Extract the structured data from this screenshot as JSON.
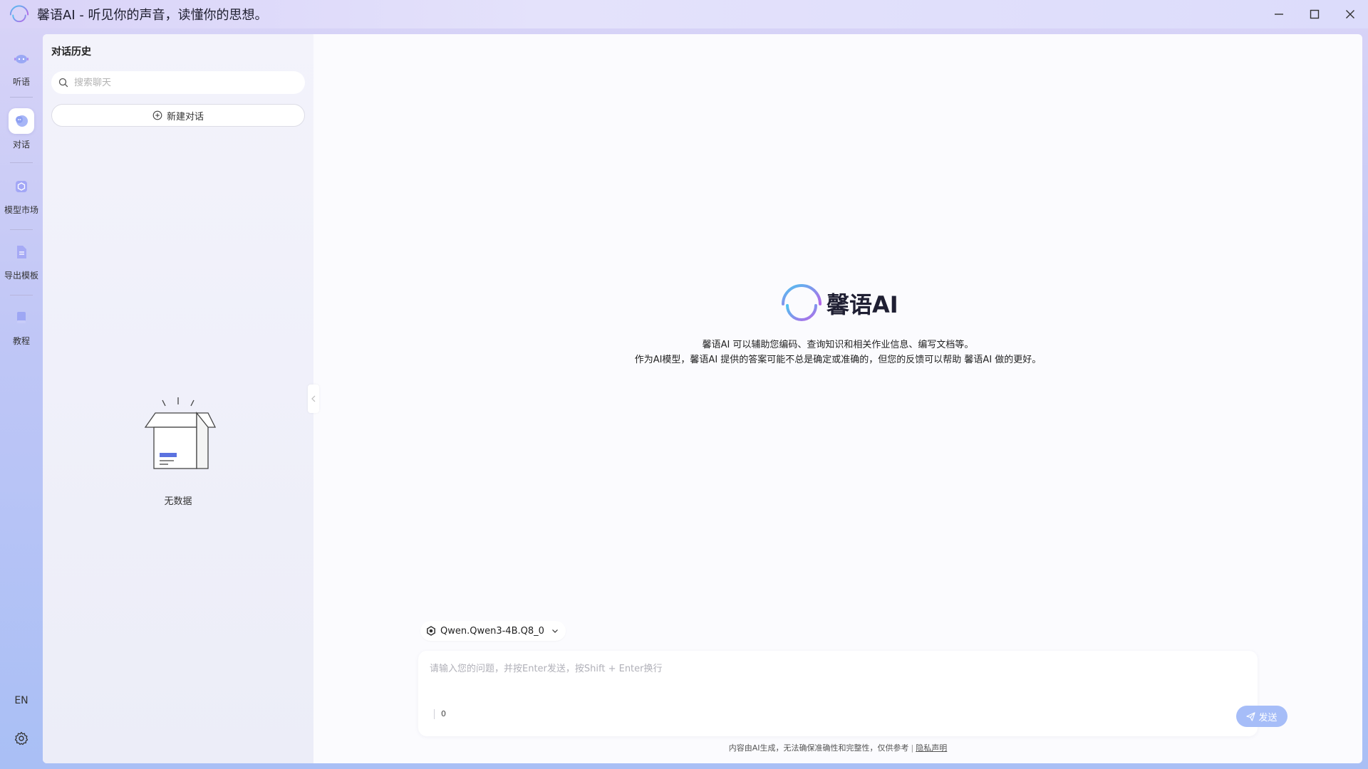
{
  "window": {
    "title": "馨语AI - 听见你的声音，读懂你的思想。",
    "controls": [
      "minimize",
      "maximize",
      "close"
    ]
  },
  "nav": {
    "items": [
      {
        "label": "听语",
        "icon": "listen-icon",
        "active": false
      },
      {
        "label": "对话",
        "icon": "chat-icon",
        "active": true
      },
      {
        "label": "模型市场",
        "icon": "model-market-icon",
        "active": false
      },
      {
        "label": "导出模板",
        "icon": "export-template-icon",
        "active": false
      },
      {
        "label": "教程",
        "icon": "tutorial-book-icon",
        "active": false
      }
    ],
    "language": "EN"
  },
  "history": {
    "title": "对话历史",
    "search_placeholder": "搜索聊天",
    "new_chat_label": "新建对话",
    "empty_label": "无数据"
  },
  "hero": {
    "brand": "馨语AI",
    "line1": "馨语AI 可以辅助您编码、查询知识和相关作业信息、编写文档等。",
    "line2": "作为AI模型，馨语AI 提供的答案可能不总是确定或准确的，但您的反馈可以帮助 馨语AI 做的更好。"
  },
  "model_selector": {
    "selected": "Qwen.Qwen3-4B.Q8_0"
  },
  "composer": {
    "placeholder": "请输入您的问题，并按Enter发送，按Shift + Enter换行",
    "char_count": "0",
    "send_label": "发送"
  },
  "footer": {
    "note": "内容由AI生成，无法确保准确性和完整性，仅供参考",
    "separator": "|",
    "privacy_link": "隐私声明"
  },
  "colors": {
    "accent": "#a6bdf8",
    "logo_gradient_start": "#5ab8f0",
    "logo_gradient_end": "#b466e8"
  }
}
